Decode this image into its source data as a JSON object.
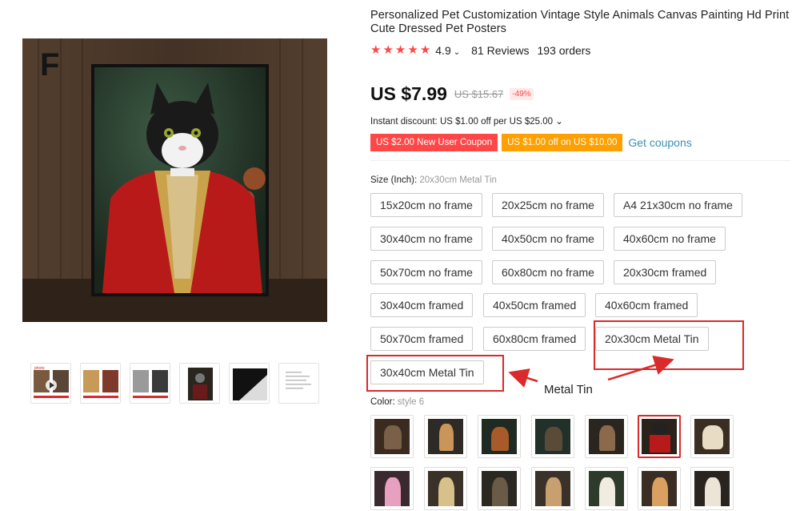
{
  "product": {
    "title": "Personalized Pet Customization Vintage Style Animals Canvas Painting Hd Print Cute Dressed Pet Posters",
    "rating": "4.9",
    "reviews": "81 Reviews",
    "orders": "193 orders",
    "price": "US $7.99",
    "original_price": "US $15.67",
    "discount": "-49%",
    "instant_discount": "Instant discount: US $1.00 off per US $25.00 ⌄",
    "coupons": [
      {
        "label": "US $2.00 New User Coupon",
        "color": "#ff4747"
      },
      {
        "label": "US $1.00 off on US $10.00",
        "color": "#ff9f00"
      }
    ],
    "get_coupons": "Get coupons"
  },
  "gallery": {
    "main_image_letter": "F",
    "thumbnails": [
      "thumb-1",
      "thumb-2",
      "thumb-3",
      "thumb-4",
      "thumb-5",
      "thumb-6"
    ]
  },
  "size": {
    "label": "Size (Inch):",
    "selected": "20x30cm Metal Tin",
    "options": [
      "15x20cm no frame",
      "20x25cm no frame",
      "A4 21x30cm no frame",
      "30x40cm no frame",
      "40x50cm no frame",
      "40x60cm no frame",
      "50x70cm no frame",
      "60x80cm no frame",
      "20x30cm framed",
      "30x40cm framed",
      "40x50cm framed",
      "40x60cm framed",
      "50x70cm framed",
      "60x80cm framed",
      "20x30cm Metal Tin",
      "30x40cm Metal Tin"
    ]
  },
  "annotation": {
    "text": "Metal Tin",
    "color": "#d92b2b"
  },
  "color": {
    "label": "Color:",
    "selected": "style 6",
    "swatches": [
      "style 1",
      "style 2",
      "style 3",
      "style 4",
      "style 5",
      "style 6",
      "style 7",
      "style 8",
      "style 9",
      "style 10",
      "style 11",
      "style 12",
      "style 13",
      "style 14"
    ]
  },
  "colors": {
    "accent": "#ff4747",
    "orange": "#ff9f00",
    "link": "#3a8fb5"
  }
}
